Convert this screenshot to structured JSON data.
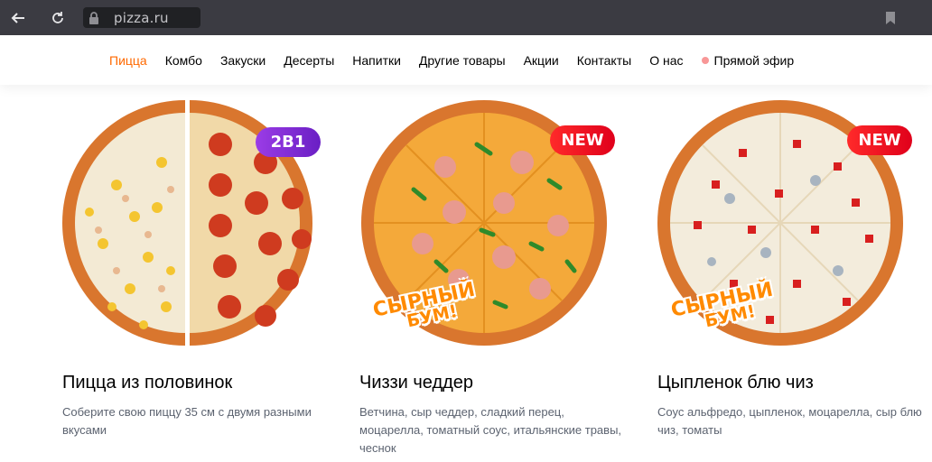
{
  "browser": {
    "url": "pizza.ru",
    "icons": [
      "back-arrow-icon",
      "reload-icon",
      "lock-icon",
      "bookmark-icon"
    ]
  },
  "nav": {
    "items": [
      {
        "label": "Пицца",
        "active": true
      },
      {
        "label": "Комбо"
      },
      {
        "label": "Закуски"
      },
      {
        "label": "Десерты"
      },
      {
        "label": "Напитки"
      },
      {
        "label": "Другие товары"
      },
      {
        "label": "Акции"
      },
      {
        "label": "Контакты"
      },
      {
        "label": "О нас"
      }
    ],
    "live_label": "Прямой эфир",
    "accent_color": "#ff6900"
  },
  "products": [
    {
      "title": "Пицца из половинок",
      "description": "Соберите свою пиццу 35 см с двумя разными вкусами",
      "badge": "2В1",
      "badge_color": "#7b2ad6"
    },
    {
      "title": "Чиззи чеддер",
      "description": "Ветчина, сыр чеддер, сладкий перец, моцарелла, томатный соус, итальянские травы, чеснок",
      "badge": "NEW",
      "badge_color": "#ff1a1a",
      "stamp_line1": "СЫРНЫЙ",
      "stamp_line2": "БУМ!"
    },
    {
      "title": "Цыпленок блю чиз",
      "description": "Соус альфредо, цыпленок, моцарелла, сыр блю чиз, томаты",
      "badge": "NEW",
      "badge_color": "#ff1a1a",
      "stamp_line1": "СЫРНЫЙ",
      "stamp_line2": "БУМ!"
    }
  ]
}
